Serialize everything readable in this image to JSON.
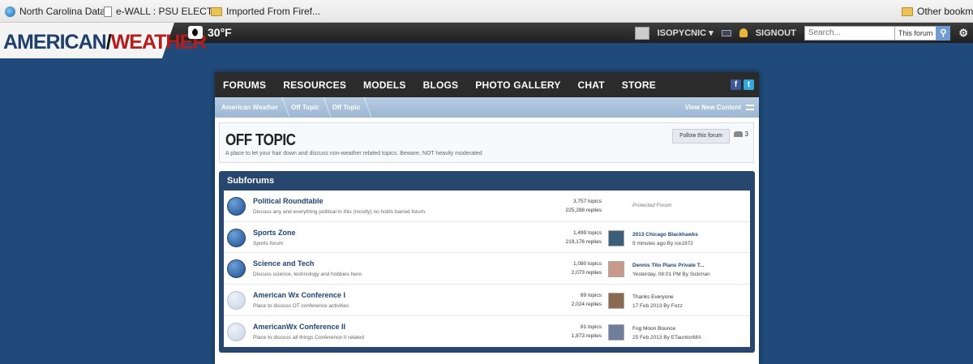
{
  "browser": {
    "bookmarks": [
      {
        "label": "North Carolina Data",
        "icon": "globe-icon"
      },
      {
        "label": "e-WALL : PSU ELECT...",
        "icon": "page-icon"
      },
      {
        "label": "Imported From Firef...",
        "icon": "folder-icon"
      }
    ],
    "other_bookmarks": "Other bookma"
  },
  "site": {
    "logo_left": "AMERICAN",
    "logo_bolt": "/",
    "logo_right": "WEATHER",
    "temperature": "30°F"
  },
  "user": {
    "name": "ISOPYCNIC",
    "caret": "▾",
    "signout": "SIGNOUT",
    "search_placeholder": "Search...",
    "search_scope": "This forum"
  },
  "nav": {
    "items": [
      "FORUMS",
      "RESOURCES",
      "MODELS",
      "BLOGS",
      "PHOTO GALLERY",
      "CHAT",
      "STORE"
    ],
    "fb": "f",
    "tw": "t"
  },
  "breadcrumb": {
    "items": [
      "American Weather",
      "Off Topic",
      "Off Topic"
    ],
    "view_new": "View New Content"
  },
  "forum": {
    "title": "OFF TOPIC",
    "description": "A place to let your hair down and discuss non-weather related topics. Beware, NOT heavily moderated",
    "follow_label": "Follow this forum",
    "followers": "3"
  },
  "subforums": {
    "heading": "Subforums",
    "rows": [
      {
        "name": "Political Roundtable",
        "desc": "Discuss any and everything political in this (mostly) no holds barred forum.",
        "topics": "3,757 topics",
        "replies": "225,288 replies",
        "last_title": "",
        "last_meta": "",
        "protected": "Protected Forum"
      },
      {
        "name": "Sports Zone",
        "desc": "Sports forum",
        "topics": "1,499 topics",
        "replies": "219,176 replies",
        "last_title": "2013 Chicago Blackhawks",
        "last_meta": "9 minutes ago By ice1972",
        "protected": ""
      },
      {
        "name": "Science and Tech",
        "desc": "Discuss science, technology and hobbies here.",
        "topics": "1,080 topics",
        "replies": "2,073 replies",
        "last_title": "Dennis Tito Plans Private T...",
        "last_meta": "Yesterday, 08:01 PM By Sickman",
        "protected": ""
      },
      {
        "name": "American Wx Conference I",
        "desc": "Place to discuss OT conference activities",
        "topics": "89 topics",
        "replies": "2,024 replies",
        "last_title": "Thanks Everyone",
        "last_meta": "17 Feb 2013 By Fozz",
        "protected": ""
      },
      {
        "name": "AmericanWx Conference II",
        "desc": "Place to discuss all things Conference II related",
        "topics": "81 topics",
        "replies": "1,873 replies",
        "last_title": "Fog Moon Bounce",
        "last_meta": "25 Feb 2013 By ETauntonMA",
        "protected": ""
      }
    ]
  }
}
